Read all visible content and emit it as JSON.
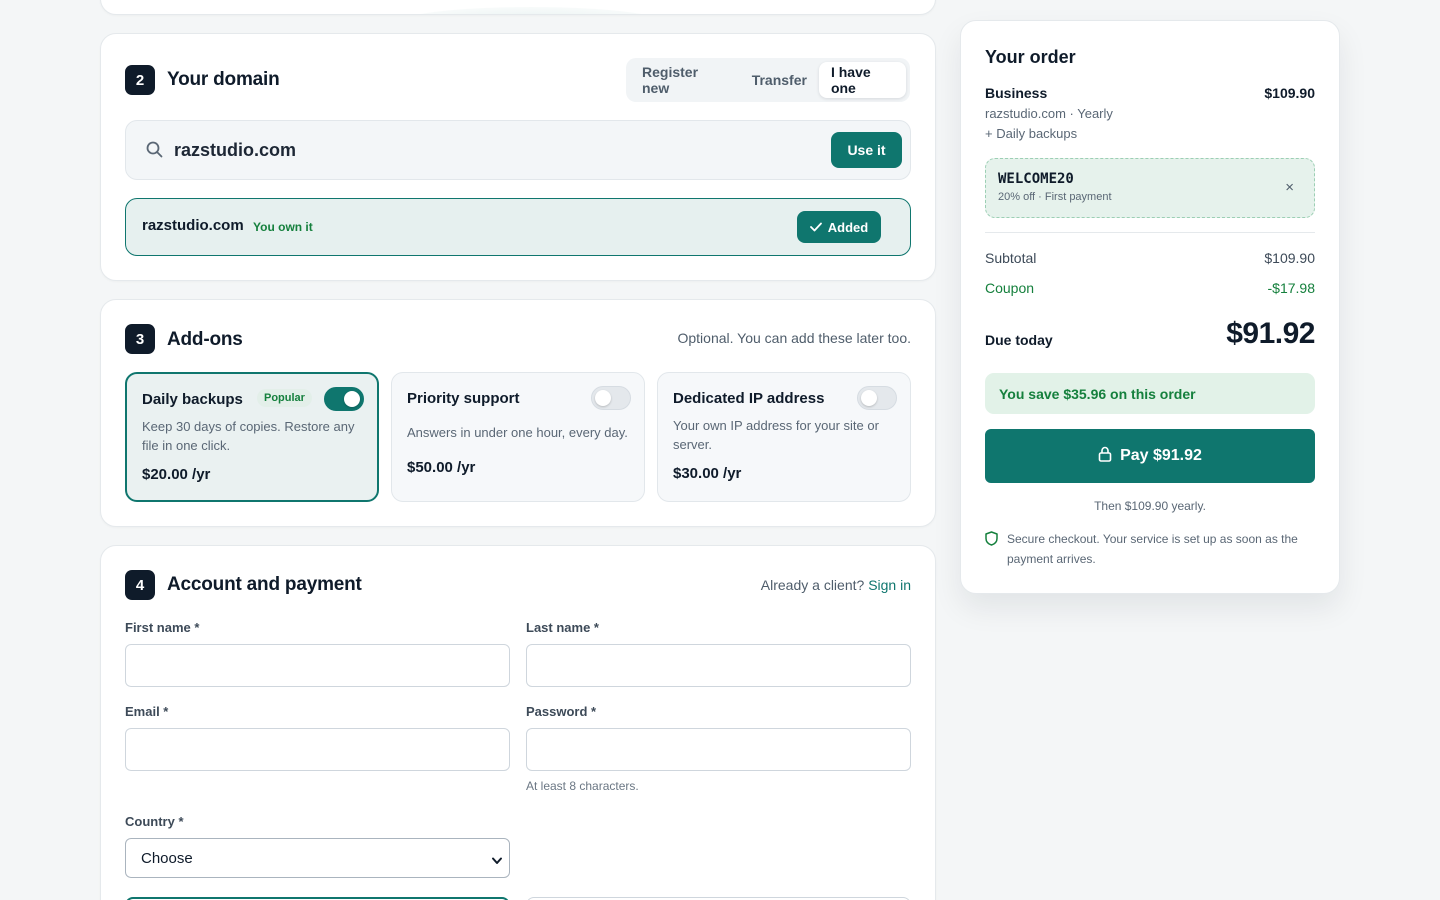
{
  "colors": {
    "accent": "#0f766e",
    "success": "#15803d",
    "dark": "#0f1b2a"
  },
  "domain_section": {
    "step": "2",
    "title": "Your domain",
    "tabs": [
      {
        "label": "Register new",
        "active": false
      },
      {
        "label": "Transfer",
        "active": false
      },
      {
        "label": "I have one",
        "active": true
      }
    ],
    "search_value": "razstudio.com",
    "use_button": "Use it",
    "result": {
      "domain": "razstudio.com",
      "tag": "You own it",
      "added_label": "Added"
    }
  },
  "addons_section": {
    "step": "3",
    "title": "Add-ons",
    "note": "Optional. You can add these later too.",
    "items": [
      {
        "title": "Daily backups",
        "badge": "Popular",
        "desc": "Keep 30 days of copies. Restore any file in one click.",
        "price": "$20.00 /yr",
        "enabled": true
      },
      {
        "title": "Priority support",
        "desc": "Answers in under one hour, every day.",
        "price": "$50.00 /yr",
        "enabled": false
      },
      {
        "title": "Dedicated IP address",
        "desc": "Your own IP address for your site or server.",
        "price": "$30.00 /yr",
        "enabled": false
      }
    ]
  },
  "account_section": {
    "step": "4",
    "title": "Account and payment",
    "signin_prompt": "Already a client?",
    "signin_link": "Sign in",
    "fields": {
      "first_name": "First name *",
      "last_name": "Last name *",
      "email": "Email *",
      "password": "Password *",
      "password_hint": "At least 8 characters.",
      "country": "Country *",
      "country_value": "Choose"
    }
  },
  "order": {
    "title": "Your order",
    "plan": "Business",
    "plan_price": "$109.90",
    "plan_detail": "razstudio.com · Yearly",
    "addon_line": "+ Daily backups",
    "coupon": {
      "code": "WELCOME20",
      "desc": "20% off · First payment",
      "remove": "×"
    },
    "subtotal_label": "Subtotal",
    "subtotal_value": "$109.90",
    "coupon_label": "Coupon",
    "coupon_value": "-$17.98",
    "due_label": "Due today",
    "due_value": "$91.92",
    "savings": "You save $35.96 on this order",
    "pay_label": "Pay $91.92",
    "then_text": "Then $109.90 yearly.",
    "secure_text": "Secure checkout. Your service is set up as soon as the payment arrives."
  }
}
